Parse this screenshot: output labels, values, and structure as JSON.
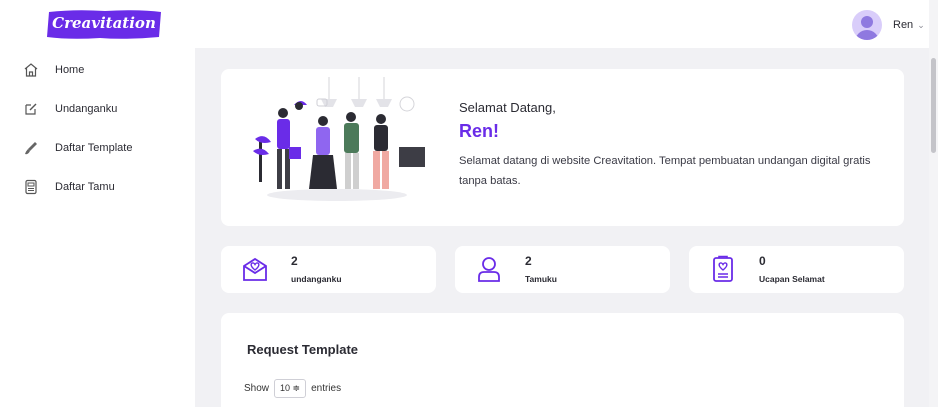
{
  "brand": {
    "name": "Creavitation",
    "color": "#6a2ce8"
  },
  "user": {
    "name": "Ren"
  },
  "sidebar": {
    "items": [
      {
        "label": "Home",
        "icon": "home-icon"
      },
      {
        "label": "Undanganku",
        "icon": "edit-icon"
      },
      {
        "label": "Daftar Template",
        "icon": "brush-icon"
      },
      {
        "label": "Daftar Tamu",
        "icon": "clipboard-icon"
      }
    ]
  },
  "welcome": {
    "greeting": "Selamat Datang,",
    "name": "Ren!",
    "description": "Selamat datang di website Creavitation. Tempat pembuatan undangan digital gratis tanpa batas."
  },
  "stats": [
    {
      "value": "2",
      "label": "undanganku",
      "icon": "envelope-heart-icon"
    },
    {
      "value": "2",
      "label": "Tamuku",
      "icon": "user-icon"
    },
    {
      "value": "0",
      "label": "Ucapan Selamat",
      "icon": "card-heart-icon"
    }
  ],
  "request": {
    "title": "Request Template",
    "show_label": "Show",
    "entries_value": "10 ≑",
    "entries_label": "entries"
  }
}
